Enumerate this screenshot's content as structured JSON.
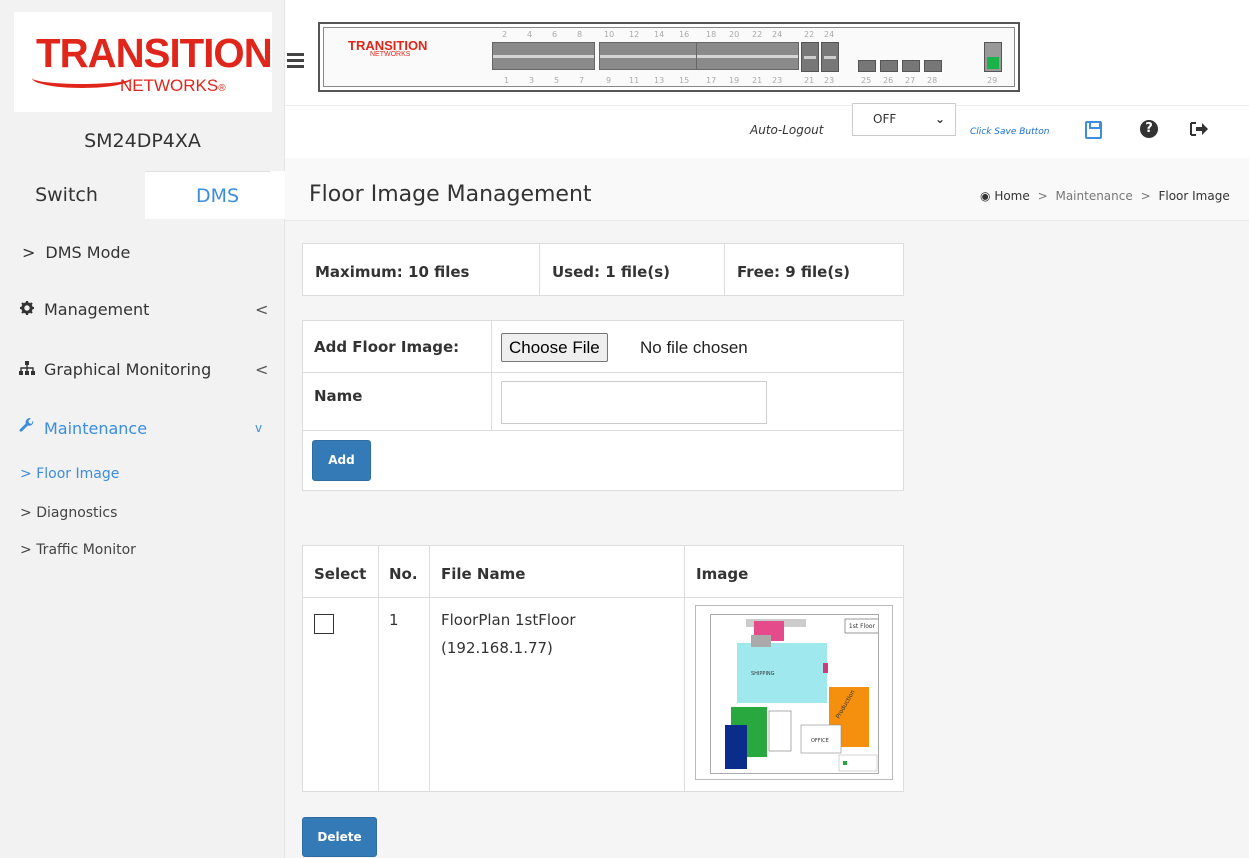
{
  "brand": {
    "logo_text": "TRANSITION",
    "logo_sub": "NETWORKS",
    "logo_mark": "®",
    "panel_logo": "TRANSITION",
    "panel_logo_sub": "NETWORKS"
  },
  "device": {
    "name": "SM24DP4XA"
  },
  "sidebar": {
    "tabs": [
      {
        "label": "Switch"
      },
      {
        "label": "DMS"
      }
    ],
    "menu": [
      {
        "label": "DMS Mode",
        "prefix": ">"
      },
      {
        "label": "Management",
        "caret": "<"
      },
      {
        "label": "Graphical Monitoring",
        "caret": "<"
      },
      {
        "label": "Maintenance",
        "caret": "v"
      }
    ],
    "submenu": [
      {
        "label": "Floor Image",
        "prefix": ">"
      },
      {
        "label": "Diagnostics",
        "prefix": ">"
      },
      {
        "label": "Traffic Monitor",
        "prefix": ">"
      }
    ]
  },
  "ports": {
    "top_numbers": [
      "2",
      "4",
      "6",
      "8",
      "10",
      "12",
      "14",
      "16",
      "18",
      "20",
      "22",
      "24",
      "22",
      "24"
    ],
    "bottom_numbers": [
      "1",
      "3",
      "5",
      "7",
      "9",
      "11",
      "13",
      "15",
      "17",
      "19",
      "21",
      "23",
      "21",
      "23",
      "25",
      "26",
      "27",
      "28",
      "29"
    ]
  },
  "toolbar": {
    "auto_logout_label": "Auto-Logout",
    "auto_logout_value": "OFF",
    "save_hint": "Click Save Button"
  },
  "page": {
    "title": "Floor Image Management",
    "breadcrumb": {
      "home": "Home",
      "sep": ">",
      "section": "Maintenance",
      "current": "Floor Image"
    }
  },
  "summary": {
    "maximum": "Maximum: 10 files",
    "used": "Used: 1 file(s)",
    "free": "Free: 9 file(s)"
  },
  "add_form": {
    "add_label": "Add Floor Image:",
    "choose_file": "Choose File",
    "file_status": "No file chosen",
    "name_label": "Name",
    "name_value": "",
    "add_button": "Add"
  },
  "table": {
    "headers": [
      "Select",
      "No.",
      "File Name",
      "Image"
    ],
    "rows": [
      {
        "no": "1",
        "file_name": "FloorPlan 1stFloor (192.168.1.77)",
        "selected": false
      }
    ],
    "thumbnail": {
      "floor_label": "1st Floor",
      "room_label": "SHIPPING",
      "zone_label": "Production",
      "office_label": "OFFICE"
    }
  },
  "actions": {
    "delete_button": "Delete"
  },
  "colors": {
    "accent": "#3c8dde",
    "brand_red": "#e0261b",
    "button": "#337ab7"
  }
}
